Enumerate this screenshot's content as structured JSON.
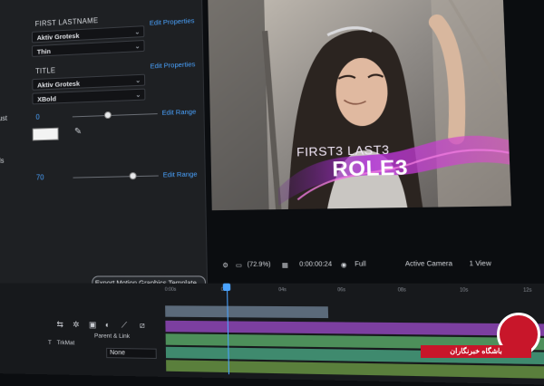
{
  "properties_panel": {
    "rows": [
      {
        "label": "",
        "value": "FIRST LASTNAME",
        "link": ""
      },
      {
        "label": "",
        "select": "Aktiv Grotesk",
        "link": "Edit Properties"
      },
      {
        "label": "",
        "select": "Thin",
        "link": ""
      },
      {
        "label": "xt",
        "value": "TITLE",
        "link": "Edit Properties"
      },
      {
        "label": "t",
        "select": "Aktiv Grotesk",
        "link": ""
      },
      {
        "label": "",
        "select": "XBold",
        "link": ""
      },
      {
        "label": "djust",
        "number": "0",
        "link": "Edit Range",
        "slider": 0.42
      },
      {
        "label": "or",
        "link": ""
      },
      {
        "label": "rols",
        "link": ""
      },
      {
        "label": "ty",
        "number": "70",
        "link": "Edit Range",
        "slider": 0.7
      }
    ],
    "export_button": "Export Motion Graphics Template..."
  },
  "monitor": {
    "overlay_line1": "FIRST3 LAST3",
    "overlay_line2": "ROLE3"
  },
  "monitor_controls": {
    "zoom": "(72.9%)",
    "timecode": "0:00:00:24",
    "resolution": "Full",
    "camera": "Active Camera",
    "view": "1 View"
  },
  "timeline": {
    "ruler_labels": [
      "0:00s",
      "02s",
      "04s",
      "06s",
      "08s",
      "10s",
      "12s",
      "14s"
    ],
    "column_headers": [
      "T",
      "TrkMat",
      "Parent & Link"
    ],
    "parent_value": "None"
  },
  "watermark": {
    "text": "باشگاه خبرنگاران",
    "logo_color": "#c8162a"
  },
  "colors": {
    "accent": "#4aa3ff",
    "panel": "#1e2023",
    "overlay_purple": "#b02fd6"
  }
}
